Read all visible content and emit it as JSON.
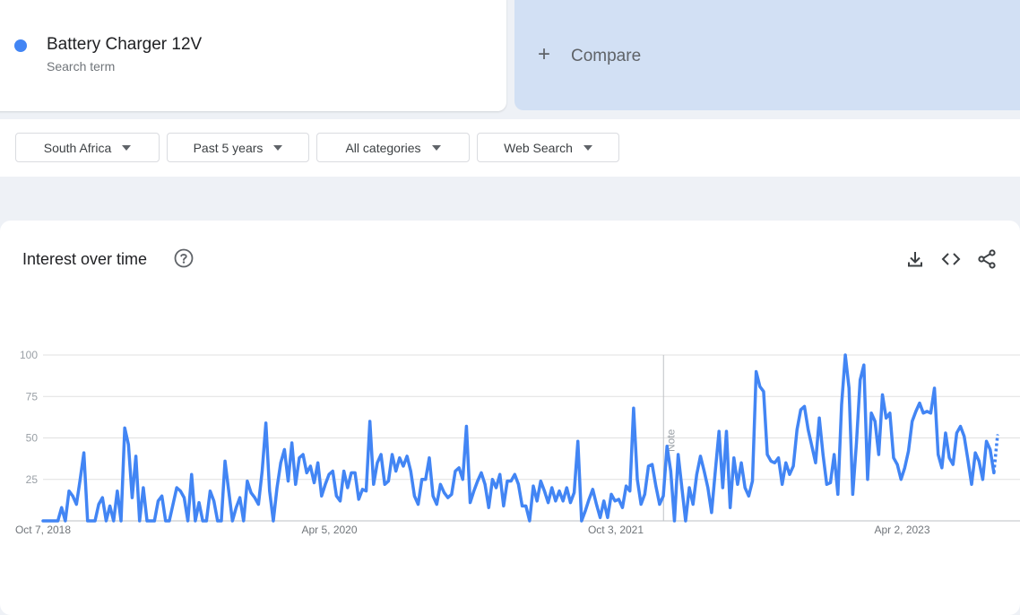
{
  "search_term": {
    "name": "Battery Charger 12V",
    "subtitle": "Search term",
    "color": "#4285f4"
  },
  "compare": {
    "icon": "plus-icon",
    "label": "Compare"
  },
  "filters": [
    {
      "label": "South Africa"
    },
    {
      "label": "Past 5 years"
    },
    {
      "label": "All categories"
    },
    {
      "label": "Web Search"
    }
  ],
  "panel": {
    "title": "Interest over time",
    "icons": [
      "help-icon",
      "download-icon",
      "embed-code-icon",
      "share-icon"
    ]
  },
  "chart_data": {
    "type": "line",
    "title": "",
    "xlabel": "",
    "ylabel": "",
    "ylim": [
      0,
      100
    ],
    "yticks": [
      25,
      50,
      75,
      100
    ],
    "x_tick_labels": [
      "Oct 7, 2018",
      "Apr 5, 2020",
      "Oct 3, 2021",
      "Apr 2, 2023"
    ],
    "x_tick_dates": [
      "2018-10-07",
      "2020-04-05",
      "2021-10-03",
      "2023-04-02"
    ],
    "x_start": "2018-10-07",
    "x_end": "2023-10-01",
    "note": {
      "date": "2022-01-02",
      "label": "Note"
    },
    "partial_last_point": true,
    "grid": true,
    "series": [
      {
        "color": "#4285f4",
        "values": [
          0,
          0,
          0,
          0,
          0,
          8,
          0,
          18,
          15,
          10,
          25,
          41,
          0,
          0,
          0,
          10,
          14,
          0,
          9,
          0,
          18,
          0,
          56,
          46,
          14,
          39,
          0,
          20,
          0,
          0,
          0,
          12,
          15,
          0,
          0,
          10,
          20,
          18,
          14,
          0,
          28,
          0,
          11,
          0,
          0,
          18,
          12,
          0,
          0,
          36,
          18,
          0,
          8,
          14,
          0,
          24,
          17,
          14,
          10,
          30,
          59,
          18,
          0,
          20,
          35,
          43,
          24,
          47,
          22,
          38,
          40,
          29,
          33,
          23,
          35,
          15,
          22,
          28,
          30,
          15,
          12,
          30,
          20,
          29,
          29,
          13,
          19,
          18,
          60,
          22,
          35,
          40,
          22,
          24,
          40,
          30,
          38,
          33,
          39,
          30,
          15,
          10,
          25,
          25,
          38,
          15,
          10,
          22,
          17,
          14,
          16,
          30,
          32,
          25,
          57,
          11,
          18,
          24,
          29,
          22,
          8,
          25,
          20,
          28,
          9,
          24,
          24,
          28,
          22,
          9,
          9,
          0,
          21,
          12,
          24,
          18,
          11,
          20,
          12,
          18,
          12,
          20,
          11,
          17,
          48,
          0,
          6,
          13,
          19,
          10,
          2,
          12,
          2,
          16,
          12,
          13,
          8,
          21,
          18,
          68,
          25,
          10,
          16,
          33,
          34,
          21,
          10,
          15,
          45,
          30,
          0,
          40,
          20,
          0,
          20,
          10,
          28,
          39,
          30,
          20,
          5,
          30,
          54,
          20,
          54,
          8,
          38,
          22,
          35,
          20,
          15,
          24,
          90,
          81,
          78,
          40,
          36,
          35,
          38,
          22,
          35,
          28,
          33,
          55,
          67,
          69,
          55,
          45,
          35,
          62,
          40,
          22,
          23,
          40,
          16,
          70,
          100,
          80,
          16,
          47,
          85,
          94,
          25,
          65,
          60,
          40,
          76,
          62,
          65,
          38,
          34,
          25,
          32,
          42,
          60,
          66,
          71,
          65,
          66,
          65,
          80,
          40,
          32,
          53,
          38,
          34,
          53,
          57,
          51,
          37,
          22,
          41,
          36,
          25,
          48,
          43,
          29,
          52
        ]
      }
    ]
  }
}
